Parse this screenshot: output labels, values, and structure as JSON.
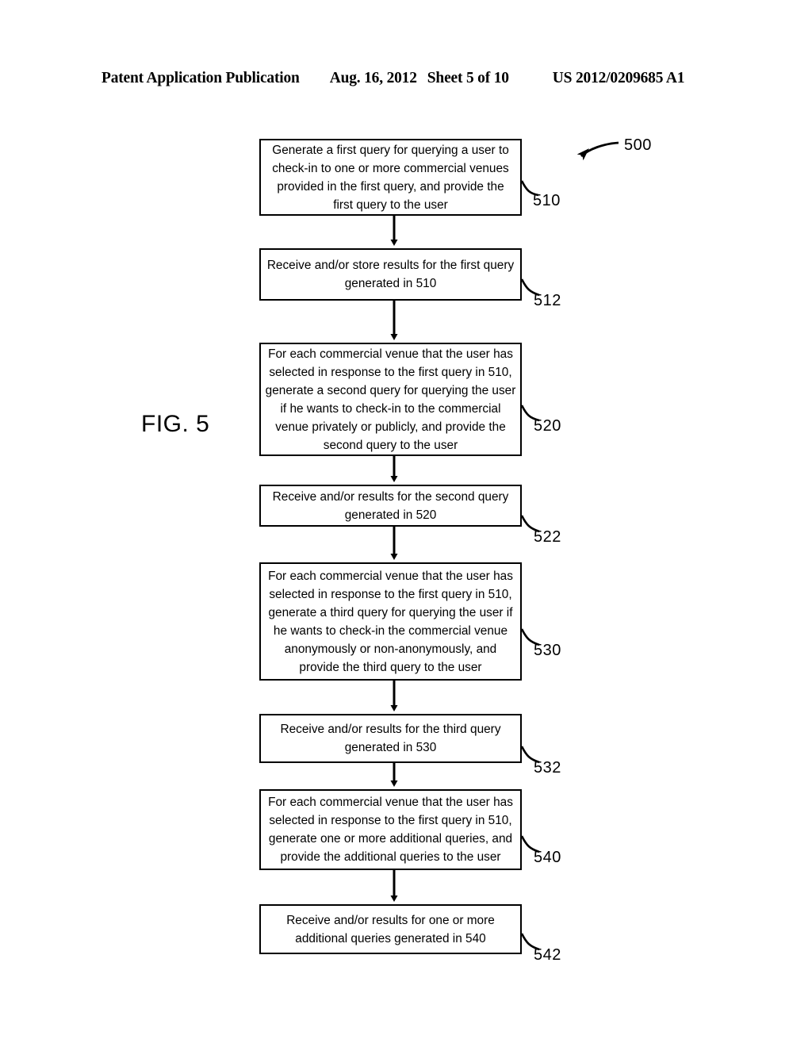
{
  "header": {
    "publication": "Patent Application Publication",
    "date": "Aug. 16, 2012",
    "sheet": "Sheet 5 of 10",
    "patent_number": "US 2012/0209685 A1"
  },
  "figure": {
    "label": "FIG. 5",
    "diagram_reference": "500",
    "type": "flowchart",
    "line_color": "#000000",
    "background_color": "#ffffff"
  },
  "steps": [
    {
      "ref": "510",
      "lines": [
        "Generate a first query for querying a user to",
        "check-in to one or more commercial venues",
        "provided in the first query, and provide the",
        "first query to the user"
      ]
    },
    {
      "ref": "512",
      "lines": [
        "Receive and/or store results for the first query",
        "generated in 510"
      ]
    },
    {
      "ref": "520",
      "lines": [
        "For each commercial venue that the user has",
        "selected in response to the first query in 510,",
        "generate a second query for querying the user",
        "if he wants to check-in to the commercial",
        "venue privately or publicly, and provide the",
        "second query to the user"
      ]
    },
    {
      "ref": "522",
      "lines": [
        "Receive and/or results for the second query",
        "generated in 520"
      ]
    },
    {
      "ref": "530",
      "lines": [
        "For each commercial venue that the user has",
        "selected in response to the first query in 510,",
        "generate a third query for querying the user if",
        "he wants to check-in the commercial venue",
        "anonymously or non-anonymously, and",
        "provide the third query to the user"
      ]
    },
    {
      "ref": "532",
      "lines": [
        "Receive and/or results for the third query",
        "generated in 530"
      ]
    },
    {
      "ref": "540",
      "lines": [
        "For each commercial venue that the user has",
        "selected in response to the first query in 510,",
        "generate one or more additional queries, and",
        "provide the additional queries to the user"
      ]
    },
    {
      "ref": "542",
      "lines": [
        "Receive and/or results for one or more",
        "additional queries generated in 540"
      ]
    }
  ]
}
